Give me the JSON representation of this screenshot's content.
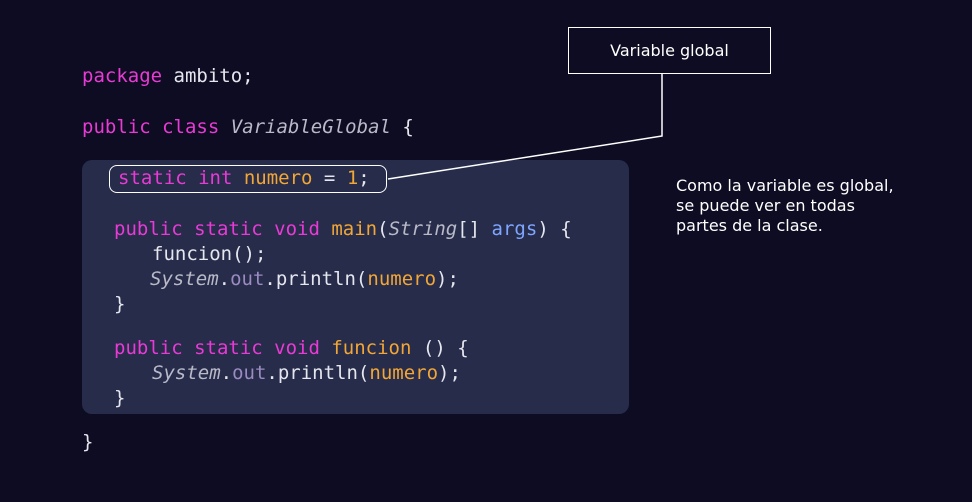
{
  "callout": {
    "label": "Variable global"
  },
  "explanation": {
    "lines": [
      "Como la variable es global,",
      "se puede ver en todas",
      "partes de la clase."
    ]
  },
  "code": {
    "package_kw": "package",
    "package_name": " ambito;",
    "class_kw": "public class",
    "class_name": "VariableGlobal",
    "open_brace": " {",
    "field_kw": "static int",
    "field_name": "numero",
    "field_assign": " = ",
    "field_value": "1",
    "semicolon": ";",
    "main_kw": "public static void",
    "main_name": "main",
    "main_param_type": "String",
    "main_param_rest": "[] ",
    "main_param_name": "args",
    "main_close": ") {",
    "call_stmt": "funcion();",
    "sys_class": "System",
    "dot": ".",
    "out_field": "out",
    "println": ".println(",
    "arg": "numero",
    "stmt_end": ");",
    "close_brace": "}",
    "funcion_kw": "public static void",
    "funcion_name": "funcion",
    "funcion_params": " () {",
    "class_close": "}"
  },
  "colors": {
    "background": "#0e0c22",
    "block": "#262c4a",
    "keyword": "#e93ad6",
    "function": "#f2a637",
    "field": "#9b8bc1",
    "param": "#7fa6ff"
  }
}
